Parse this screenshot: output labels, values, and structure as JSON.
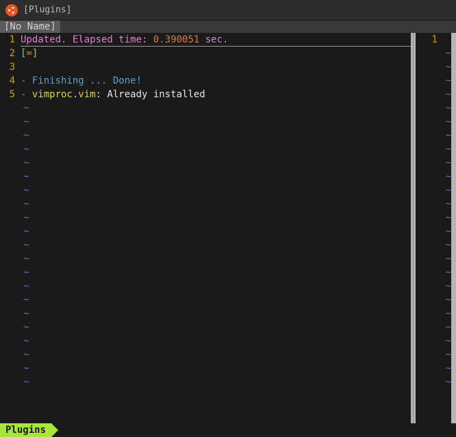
{
  "window": {
    "title": "[Plugins]"
  },
  "tabs": {
    "left_tab": "[No Name]"
  },
  "left_pane": {
    "lines": [
      {
        "num": "1",
        "segments": [
          {
            "text": "Updated. Elapsed time: ",
            "cls": "hl-magenta"
          },
          {
            "text": "0.390051",
            "cls": "hl-orange"
          },
          {
            "text": " sec.",
            "cls": "hl-magenta"
          }
        ]
      },
      {
        "num": "2",
        "segments": [
          {
            "text": "[",
            "cls": "hl-green"
          },
          {
            "text": "=",
            "cls": "hl-orange"
          },
          {
            "text": "]",
            "cls": "hl-green"
          }
        ]
      },
      {
        "num": "3",
        "segments": []
      },
      {
        "num": "4",
        "segments": [
          {
            "text": "- ",
            "cls": "hl-teal"
          },
          {
            "text": "Finishing ... Done!",
            "cls": "hl-blue"
          }
        ]
      },
      {
        "num": "5",
        "segments": [
          {
            "text": "- ",
            "cls": "hl-teal"
          },
          {
            "text": "vimproc.vim:",
            "cls": "hl-yellow"
          },
          {
            "text": " Already installed",
            "cls": "hl-white"
          }
        ]
      }
    ],
    "tilde": "~",
    "tilde_count": 21
  },
  "right_pane": {
    "line_num": "1",
    "tilde": "~",
    "tilde_count": 25
  },
  "status": {
    "left": "Plugins"
  }
}
